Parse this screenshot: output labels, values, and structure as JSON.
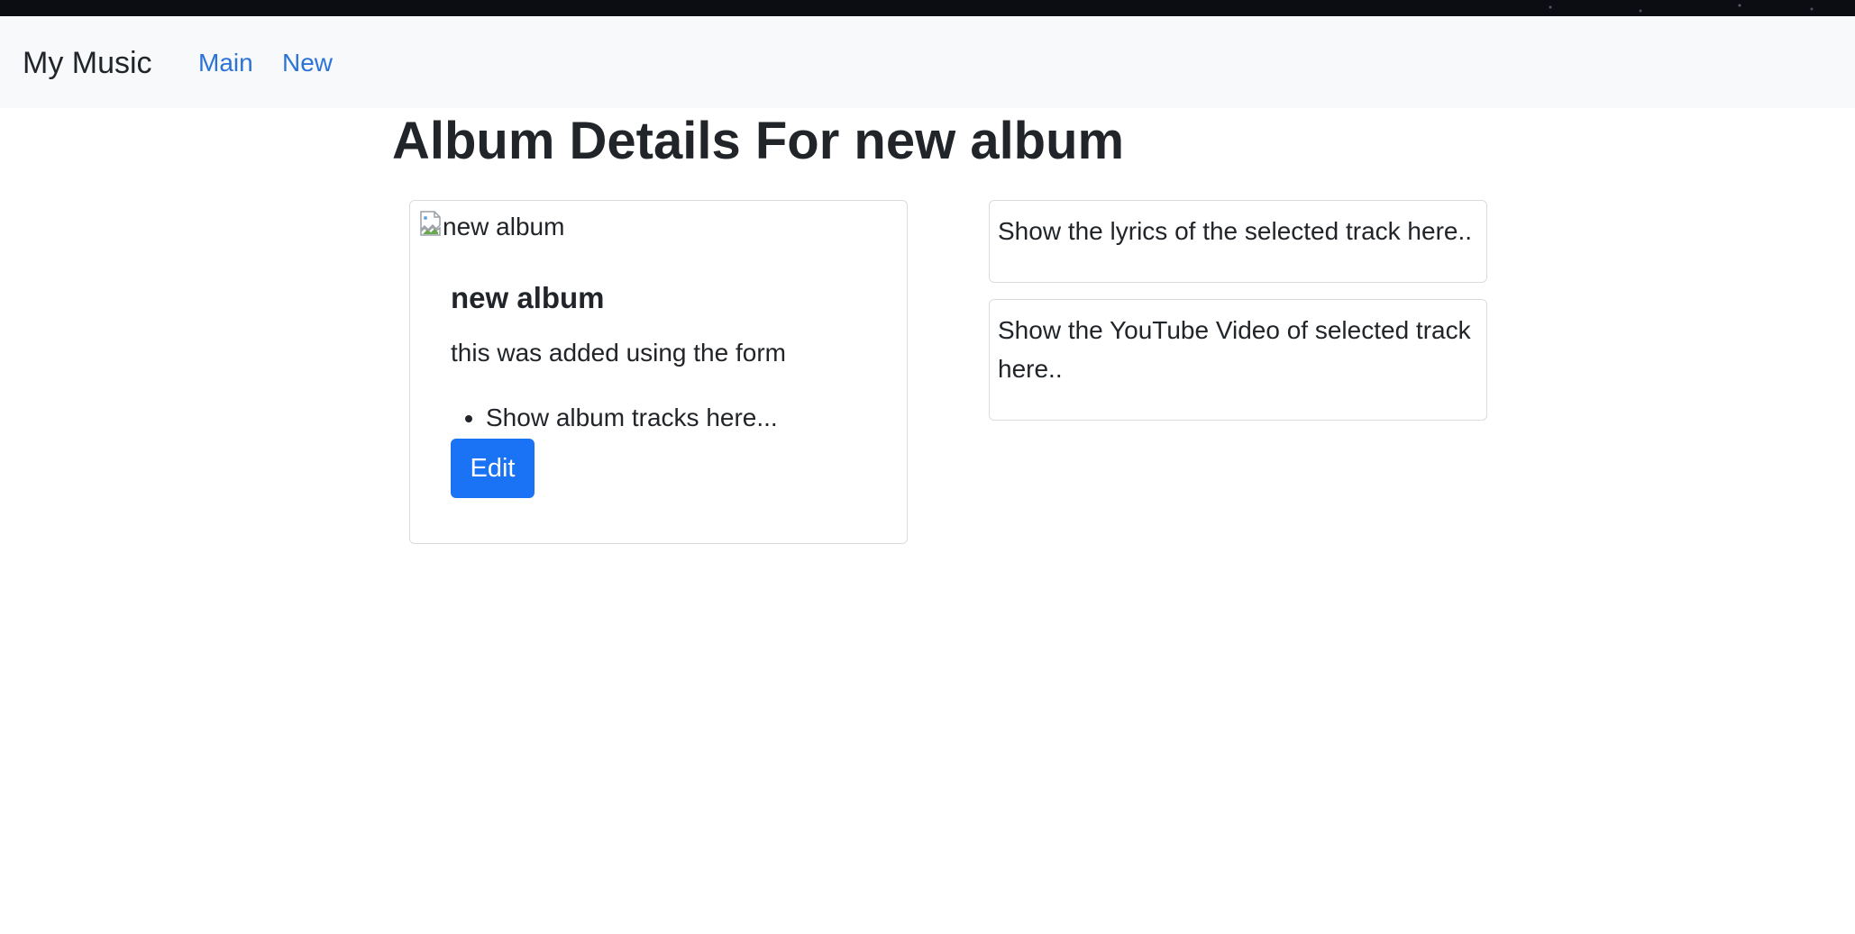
{
  "navbar": {
    "brand": "My Music",
    "links": [
      {
        "label": "Main"
      },
      {
        "label": "New"
      }
    ]
  },
  "page": {
    "title": "Album Details For new album"
  },
  "album": {
    "image_alt": "new album",
    "title": "new album",
    "description": "this was added using the form",
    "tracks": [
      "Show album tracks here..."
    ],
    "edit_label": "Edit"
  },
  "lyrics_panel": {
    "text": "Show the lyrics of the selected track here.."
  },
  "video_panel": {
    "text": "Show the YouTube Video of selected track here.."
  },
  "icons": {
    "broken_image": "broken-image-icon"
  },
  "colors": {
    "link": "#2b73d7",
    "primary_button": "#1a73f5",
    "navbar_bg": "#f8f9fa",
    "text": "#212529"
  }
}
